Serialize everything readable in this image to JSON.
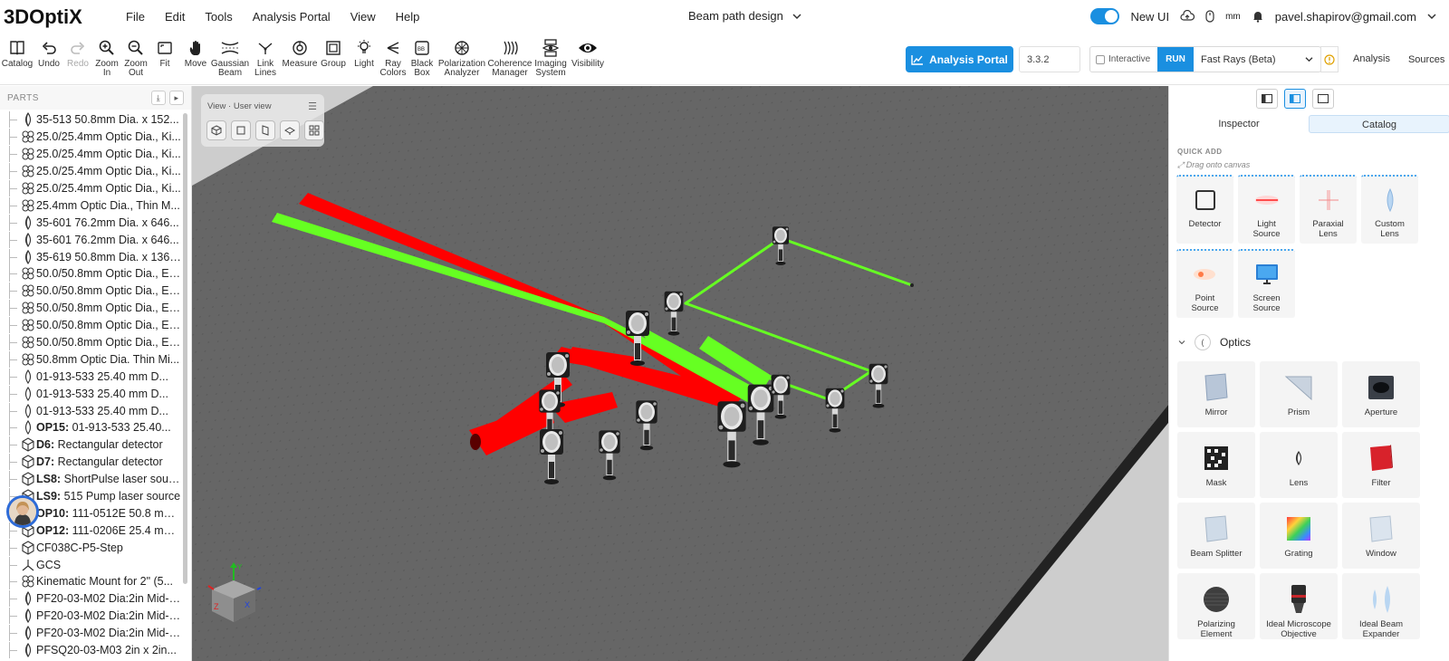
{
  "app": {
    "logo_text": "3DOptiX",
    "doc_title": "Beam path design"
  },
  "menu": [
    "File",
    "Edit",
    "Tools",
    "Analysis Portal",
    "View",
    "Help"
  ],
  "top_right": {
    "new_ui_label": "New UI",
    "unit": "mm",
    "user_email": "pavel.shapirov@gmail.com"
  },
  "toolbar": {
    "tools": [
      {
        "label": "Catalog",
        "icon": "book-icon",
        "enabled": true
      },
      {
        "label": "Undo",
        "icon": "undo-icon",
        "enabled": true
      },
      {
        "label": "Redo",
        "icon": "redo-icon",
        "enabled": false
      },
      {
        "label": "Zoom\nIn",
        "icon": "zoom-in-icon",
        "enabled": true
      },
      {
        "label": "Zoom\nOut",
        "icon": "zoom-out-icon",
        "enabled": true
      },
      {
        "label": "Fit",
        "icon": "fit-icon",
        "enabled": true
      },
      {
        "label": "Move",
        "icon": "hand-icon",
        "enabled": true
      },
      {
        "label": "Gaussian\nBeam",
        "icon": "gaussian-beam-icon",
        "enabled": true
      },
      {
        "label": "Link\nLines",
        "icon": "link-lines-icon",
        "enabled": true
      },
      {
        "label": "Measure",
        "icon": "measure-icon",
        "enabled": true
      },
      {
        "label": "Group",
        "icon": "group-icon",
        "enabled": true
      },
      {
        "label": "Light",
        "icon": "light-icon",
        "enabled": true
      },
      {
        "label": "Ray\nColors",
        "icon": "ray-colors-icon",
        "enabled": true
      },
      {
        "label": "Black\nBox",
        "icon": "black-box-icon",
        "enabled": true
      },
      {
        "label": "Polarization\nAnalyzer",
        "icon": "polarization-analyzer-icon",
        "enabled": true
      },
      {
        "label": "Coherence\nManager",
        "icon": "coherence-manager-icon",
        "enabled": true
      },
      {
        "label": "Imaging\nSystem",
        "icon": "imaging-system-icon",
        "enabled": true
      },
      {
        "label": "Visibility",
        "icon": "eye-icon",
        "enabled": true
      }
    ],
    "analysis_portal_label": "Analysis Portal",
    "version": "3.3.2",
    "interactive_label": "Interactive",
    "run_label": "RUN",
    "ray_mode": "Fast Rays (Beta)",
    "analysis_label": "Analysis",
    "sources_label": "Sources"
  },
  "parts_panel": {
    "title": "PARTS",
    "items": [
      {
        "icon": "lens-icon",
        "prefix": "",
        "text": "35-513 50.8mm Dia. x 152..."
      },
      {
        "icon": "assembly-icon",
        "prefix": "",
        "text": "25.0/25.4mm Optic Dia., Ki..."
      },
      {
        "icon": "assembly-icon",
        "prefix": "",
        "text": "25.0/25.4mm Optic Dia., Ki..."
      },
      {
        "icon": "assembly-icon",
        "prefix": "",
        "text": "25.0/25.4mm Optic Dia., Ki..."
      },
      {
        "icon": "assembly-icon",
        "prefix": "",
        "text": "25.0/25.4mm Optic Dia., Ki..."
      },
      {
        "icon": "assembly-icon",
        "prefix": "",
        "text": "25.4mm Optic Dia., Thin M..."
      },
      {
        "icon": "lens-icon",
        "prefix": "",
        "text": "35-601 76.2mm Dia. x 646..."
      },
      {
        "icon": "lens-icon",
        "prefix": "",
        "text": "35-601 76.2mm Dia. x 646..."
      },
      {
        "icon": "lens-icon",
        "prefix": "",
        "text": "35-619 50.8mm Dia. x 136...."
      },
      {
        "icon": "assembly-icon",
        "prefix": "",
        "text": "50.0/50.8mm Optic Dia., E-..."
      },
      {
        "icon": "assembly-icon",
        "prefix": "",
        "text": "50.0/50.8mm Optic Dia., E-..."
      },
      {
        "icon": "assembly-icon",
        "prefix": "",
        "text": "50.0/50.8mm Optic Dia., E-..."
      },
      {
        "icon": "assembly-icon",
        "prefix": "",
        "text": "50.0/50.8mm Optic Dia., E-..."
      },
      {
        "icon": "assembly-icon",
        "prefix": "",
        "text": "50.0/50.8mm Optic Dia., E-..."
      },
      {
        "icon": "assembly-icon",
        "prefix": "",
        "text": "50.8mm Optic Dia. Thin Mi..."
      },
      {
        "icon": "lens-user-icon",
        "prefix": "",
        "text": "01-913-533 25.40 mm D..."
      },
      {
        "icon": "lens-user-icon",
        "prefix": "",
        "text": "01-913-533 25.40 mm D..."
      },
      {
        "icon": "lens-user-icon",
        "prefix": "",
        "text": "01-913-533 25.40 mm D..."
      },
      {
        "icon": "lens-user-icon",
        "prefix": "OP15:",
        "text": " 01-913-533 25.40..."
      },
      {
        "icon": "cube-icon",
        "prefix": "D6:",
        "text": " Rectangular detector"
      },
      {
        "icon": "cube-icon",
        "prefix": "D7:",
        "text": " Rectangular detector"
      },
      {
        "icon": "cube-icon",
        "prefix": "LS8:",
        "text": " ShortPulse laser source"
      },
      {
        "icon": "cube-icon",
        "prefix": "LS9:",
        "text": " 515 Pump laser source"
      },
      {
        "icon": "cube-icon",
        "prefix": "OP10:",
        "text": " 111-0512E 50.8 mm..."
      },
      {
        "icon": "cube-icon",
        "prefix": "OP12:",
        "text": " 111-0206E 25.4 mm..."
      },
      {
        "icon": "cube-icon",
        "prefix": "",
        "text": "CF038C-P5-Step"
      },
      {
        "icon": "axes-icon",
        "prefix": "",
        "text": "GCS"
      },
      {
        "icon": "assembly-icon",
        "prefix": "",
        "text": "Kinematic Mount for 2\" (5..."
      },
      {
        "icon": "lens-icon",
        "prefix": "",
        "text": "PF20-03-M02 Dia:2in Mid-I..."
      },
      {
        "icon": "lens-icon",
        "prefix": "",
        "text": "PF20-03-M02 Dia:2in Mid-I..."
      },
      {
        "icon": "lens-icon",
        "prefix": "",
        "text": "PF20-03-M02 Dia:2in Mid-I..."
      },
      {
        "icon": "lens-icon",
        "prefix": "",
        "text": "PFSQ20-03-M03 2in x 2in..."
      }
    ]
  },
  "viewport": {
    "view_label": "View · User view",
    "view_buttons": [
      "perspective-view-icon",
      "front-view-icon",
      "side-view-icon",
      "top-view-icon",
      "grid-view-icon"
    ],
    "beam_colors": {
      "red": "#ff0000",
      "green": "#66ff22"
    },
    "axis_labels": [
      "Y",
      "Z",
      "X"
    ]
  },
  "right_panel": {
    "tabs": [
      "Inspector",
      "Catalog"
    ],
    "active_tab": "Catalog",
    "quick_add_title": "QUICK ADD",
    "quick_add_hint": "Drag onto canvas",
    "quick_add": [
      {
        "label": "Detector",
        "icon": "detector-icon"
      },
      {
        "label": "Light\nSource",
        "icon": "light-source-icon"
      },
      {
        "label": "Paraxial\nLens",
        "icon": "paraxial-lens-icon"
      },
      {
        "label": "Custom\nLens",
        "icon": "custom-lens-icon"
      },
      {
        "label": "Point\nSource",
        "icon": "point-source-icon"
      },
      {
        "label": "Screen\nSource",
        "icon": "screen-source-icon"
      }
    ],
    "optics_title": "Optics",
    "optics": [
      {
        "label": "Mirror",
        "icon": "mirror-icon"
      },
      {
        "label": "Prism",
        "icon": "prism-icon"
      },
      {
        "label": "Aperture",
        "icon": "aperture-icon"
      },
      {
        "label": "Mask",
        "icon": "mask-icon"
      },
      {
        "label": "Lens",
        "icon": "lens-icon"
      },
      {
        "label": "Filter",
        "icon": "filter-icon"
      },
      {
        "label": "Beam Splitter",
        "icon": "beam-splitter-icon"
      },
      {
        "label": "Grating",
        "icon": "grating-icon"
      },
      {
        "label": "Window",
        "icon": "window-icon"
      },
      {
        "label": "Polarizing\nElement",
        "icon": "polarizing-element-icon"
      },
      {
        "label": "Ideal Microscope\nObjective",
        "icon": "microscope-objective-icon"
      },
      {
        "label": "Ideal Beam\nExpander",
        "icon": "beam-expander-icon"
      }
    ]
  }
}
